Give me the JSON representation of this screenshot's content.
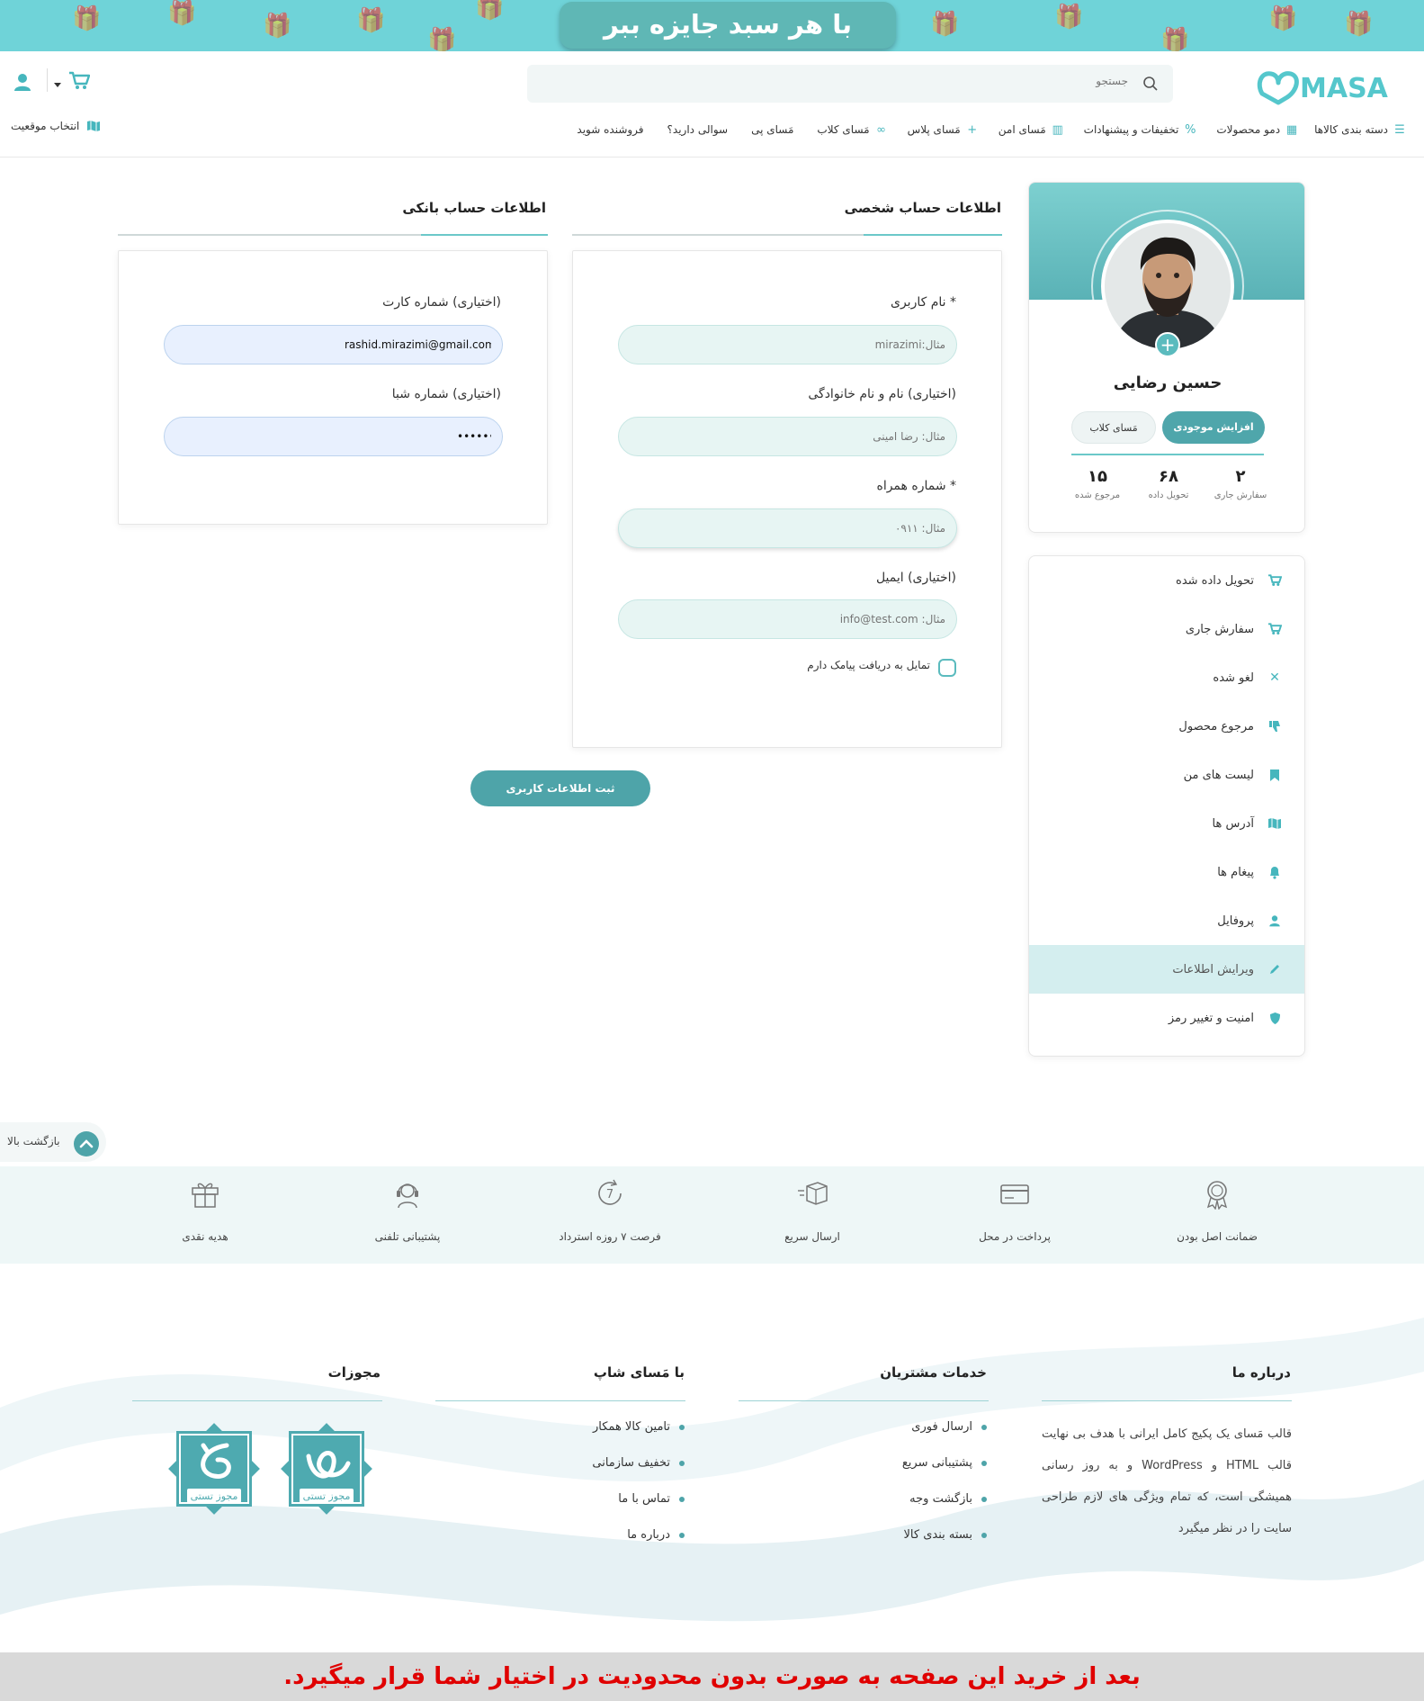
{
  "banner": {
    "text": "با هر سبد جایزه ببر",
    "bg": "#6fd3d8"
  },
  "brand": {
    "logo_text": "MASAI",
    "accent": "#4ea4a9"
  },
  "search": {
    "placeholder": "جستجو"
  },
  "nav": {
    "items": [
      {
        "label": "دسته بندی کالاها",
        "icon": "hamburger-icon"
      },
      {
        "label": "دمو محصولات",
        "icon": "film-icon"
      },
      {
        "label": "تخفیفات و پیشنهادات",
        "icon": "percent-icon"
      },
      {
        "label": "مَسای امن",
        "icon": "building-icon"
      },
      {
        "label": "مَسای پلاس",
        "icon": "plus-icon"
      },
      {
        "label": "مَسای کلاب",
        "icon": "link-icon"
      },
      {
        "label": "مَسای پی",
        "icon": ""
      },
      {
        "label": "سوالی دارید؟",
        "icon": ""
      },
      {
        "label": "فروشنده شوید",
        "icon": ""
      }
    ],
    "location": "انتخاب موقعیت"
  },
  "profile": {
    "name": "حسین رضایی",
    "charge_button": "افزایش موجودی",
    "club_button": "مَسای کلاب",
    "stats": [
      {
        "value": "۲",
        "label": "سفارش جاری"
      },
      {
        "value": "۶۸",
        "label": "تحویل داده"
      },
      {
        "value": "۱۵",
        "label": "مرجوع شده"
      }
    ]
  },
  "menu": {
    "items": [
      {
        "label": "تحویل داده شده",
        "icon": "cart-icon"
      },
      {
        "label": "سفارش جاری",
        "icon": "cart-icon"
      },
      {
        "label": "لغو شده",
        "icon": "close-icon"
      },
      {
        "label": "مرجوع محصول",
        "icon": "thumbs-down-icon"
      },
      {
        "label": "لیست های من",
        "icon": "bookmark-icon"
      },
      {
        "label": "آدرس ها",
        "icon": "map-icon"
      },
      {
        "label": "پیغام ها",
        "icon": "bell-icon"
      },
      {
        "label": "پروفایل",
        "icon": "user-icon"
      },
      {
        "label": "ویرایش اطلاعات",
        "icon": "pencil-icon",
        "active": true
      },
      {
        "label": "امنیت و تغییر رمز",
        "icon": "shield-icon"
      }
    ]
  },
  "personal": {
    "title": "اطلاعات حساب شخصی",
    "username_label": "* نام کاربری",
    "username_placeholder": "مثال:mirazimi",
    "fullname_label": "(اختیاری) نام و نام خانوادگی",
    "fullname_placeholder": "مثال: رضا امینی",
    "phone_label": "* شماره همراه",
    "phone_placeholder": "مثال: ۰۹۱۱",
    "email_label": "(اختیاری) ایمیل",
    "email_placeholder": "مثال: info@test.com",
    "sms_label": "تمایل به دریافت پیامک دارم"
  },
  "bank": {
    "title": "اطلاعات حساب بانکی",
    "card_label": "(اختیاری) شماره کارت",
    "card_value": "rashid.mirazimi@gmail.com",
    "sheba_label": "(اختیاری) شماره شبا",
    "sheba_value": "••••••••"
  },
  "submit_label": "ثبت اطلاعات کاربری",
  "back_to_top": "بازگشت بالا",
  "features": [
    {
      "label": "ضمانت اصل بودن",
      "icon": "medal-icon"
    },
    {
      "label": "پرداخت در محل",
      "icon": "credit-card-icon"
    },
    {
      "label": "ارسال سریع",
      "icon": "fast-box-icon"
    },
    {
      "label": "فرصت ۷ روزه استرداد",
      "icon": "seven-days-icon"
    },
    {
      "label": "پشتیبانی تلفنی",
      "icon": "headset-icon"
    },
    {
      "label": "هدیه نقدی",
      "icon": "gift-icon"
    }
  ],
  "footer": {
    "about": {
      "title": "درباره ما",
      "text": "قالب مَسای یک پکیج کامل ایرانی با هدف بی نهایت قالب HTML و WordPress و به روز رسانی همیشگی است، که تمام ویژگی های لازم طراحی سایت را در نظر میگیرد"
    },
    "services": {
      "title": "خدمات مشتریان",
      "links": [
        "ارسال فوری",
        "پشتیبانی سریع",
        "بازگشت وجه",
        "بسته بندی کالا"
      ]
    },
    "with_us": {
      "title": "با مَسای شاپ",
      "links": [
        "تامین کالا همکار",
        "تخفیف سازمانی",
        "تماس با ما",
        "درباره ما"
      ]
    },
    "licenses": {
      "title": "مجوزات",
      "badges": [
        "مجوز تستی",
        "مجوز تستی"
      ]
    }
  },
  "bottom_notice": "بعد از خرید این صفحه به صورت بدون محدودیت در اختیار شما قرار میگیرد."
}
